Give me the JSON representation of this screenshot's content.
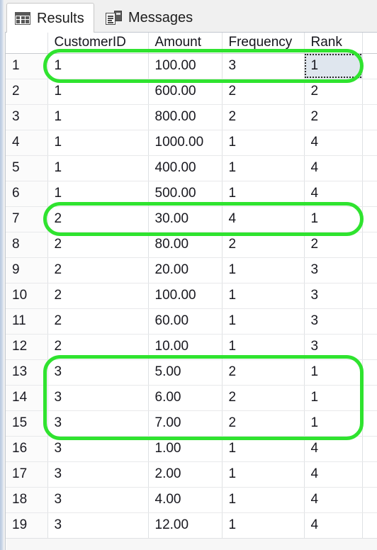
{
  "window": {
    "title": "Results",
    "accent_green": "#2fe32f",
    "selection_fill": "#dfe6ee"
  },
  "tabs": [
    {
      "id": "results",
      "label": "Results",
      "icon": "grid-icon",
      "active": true
    },
    {
      "id": "messages",
      "label": "Messages",
      "icon": "document-icon",
      "active": false
    }
  ],
  "grid": {
    "rownum_header": "",
    "columns": [
      {
        "key": "customerid",
        "label": "CustomerID"
      },
      {
        "key": "amount",
        "label": "Amount"
      },
      {
        "key": "frequency",
        "label": "Frequency"
      },
      {
        "key": "rank",
        "label": "Rank"
      }
    ],
    "rows": [
      {
        "n": "1",
        "customerid": "1",
        "amount": "100.00",
        "frequency": "3",
        "rank": "1"
      },
      {
        "n": "2",
        "customerid": "1",
        "amount": "600.00",
        "frequency": "2",
        "rank": "2"
      },
      {
        "n": "3",
        "customerid": "1",
        "amount": "800.00",
        "frequency": "2",
        "rank": "2"
      },
      {
        "n": "4",
        "customerid": "1",
        "amount": "1000.00",
        "frequency": "1",
        "rank": "4"
      },
      {
        "n": "5",
        "customerid": "1",
        "amount": "400.00",
        "frequency": "1",
        "rank": "4"
      },
      {
        "n": "6",
        "customerid": "1",
        "amount": "500.00",
        "frequency": "1",
        "rank": "4"
      },
      {
        "n": "7",
        "customerid": "2",
        "amount": "30.00",
        "frequency": "4",
        "rank": "1"
      },
      {
        "n": "8",
        "customerid": "2",
        "amount": "80.00",
        "frequency": "2",
        "rank": "2"
      },
      {
        "n": "9",
        "customerid": "2",
        "amount": "20.00",
        "frequency": "1",
        "rank": "3"
      },
      {
        "n": "10",
        "customerid": "2",
        "amount": "100.00",
        "frequency": "1",
        "rank": "3"
      },
      {
        "n": "11",
        "customerid": "2",
        "amount": "60.00",
        "frequency": "1",
        "rank": "3"
      },
      {
        "n": "12",
        "customerid": "2",
        "amount": "10.00",
        "frequency": "1",
        "rank": "3"
      },
      {
        "n": "13",
        "customerid": "3",
        "amount": "5.00",
        "frequency": "2",
        "rank": "1"
      },
      {
        "n": "14",
        "customerid": "3",
        "amount": "6.00",
        "frequency": "2",
        "rank": "1"
      },
      {
        "n": "15",
        "customerid": "3",
        "amount": "7.00",
        "frequency": "2",
        "rank": "1"
      },
      {
        "n": "16",
        "customerid": "3",
        "amount": "1.00",
        "frequency": "1",
        "rank": "4"
      },
      {
        "n": "17",
        "customerid": "3",
        "amount": "2.00",
        "frequency": "1",
        "rank": "4"
      },
      {
        "n": "18",
        "customerid": "3",
        "amount": "4.00",
        "frequency": "1",
        "rank": "4"
      },
      {
        "n": "19",
        "customerid": "3",
        "amount": "12.00",
        "frequency": "1",
        "rank": "4"
      }
    ],
    "focused_cell": {
      "row": 0,
      "column": "rank",
      "value": "1"
    }
  },
  "annotations": [
    {
      "id": "highlight-row-1",
      "rows": [
        "1"
      ],
      "shape": "rounded-rect"
    },
    {
      "id": "highlight-row-7",
      "rows": [
        "7"
      ],
      "shape": "rounded-rect"
    },
    {
      "id": "highlight-rows-13-to-15",
      "rows": [
        "13",
        "14",
        "15"
      ],
      "shape": "rounded-rect"
    }
  ]
}
